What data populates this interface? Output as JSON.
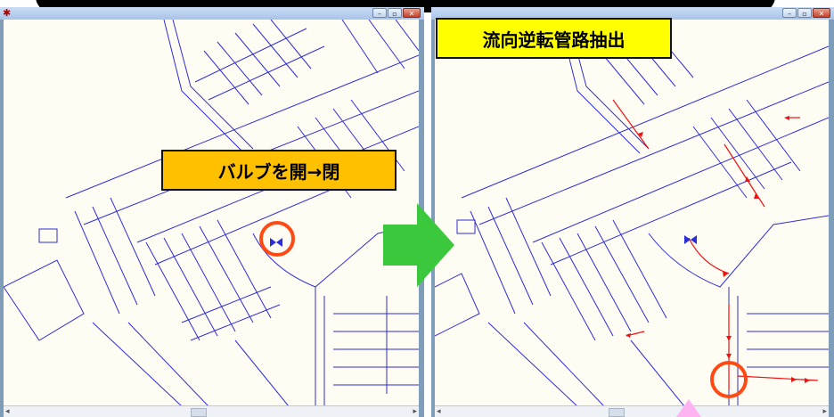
{
  "annotations": {
    "valve_label": "バルブを開→閉",
    "extract_label": "流向逆転管路抽出"
  },
  "windows": {
    "left": {
      "app_icon": "sys-icon",
      "buttons": [
        "minimize",
        "restore",
        "close"
      ]
    },
    "right": {
      "buttons": [
        "minimize",
        "restore",
        "close"
      ]
    }
  },
  "colors": {
    "pipe": "#2d2dd6",
    "reversed_pipe": "#ee1111",
    "highlight_circle": "#ff4a14",
    "transition_arrow": "#3cc83c",
    "valve_label_bg": "#ffc000",
    "extract_label_bg": "#ffff00"
  }
}
